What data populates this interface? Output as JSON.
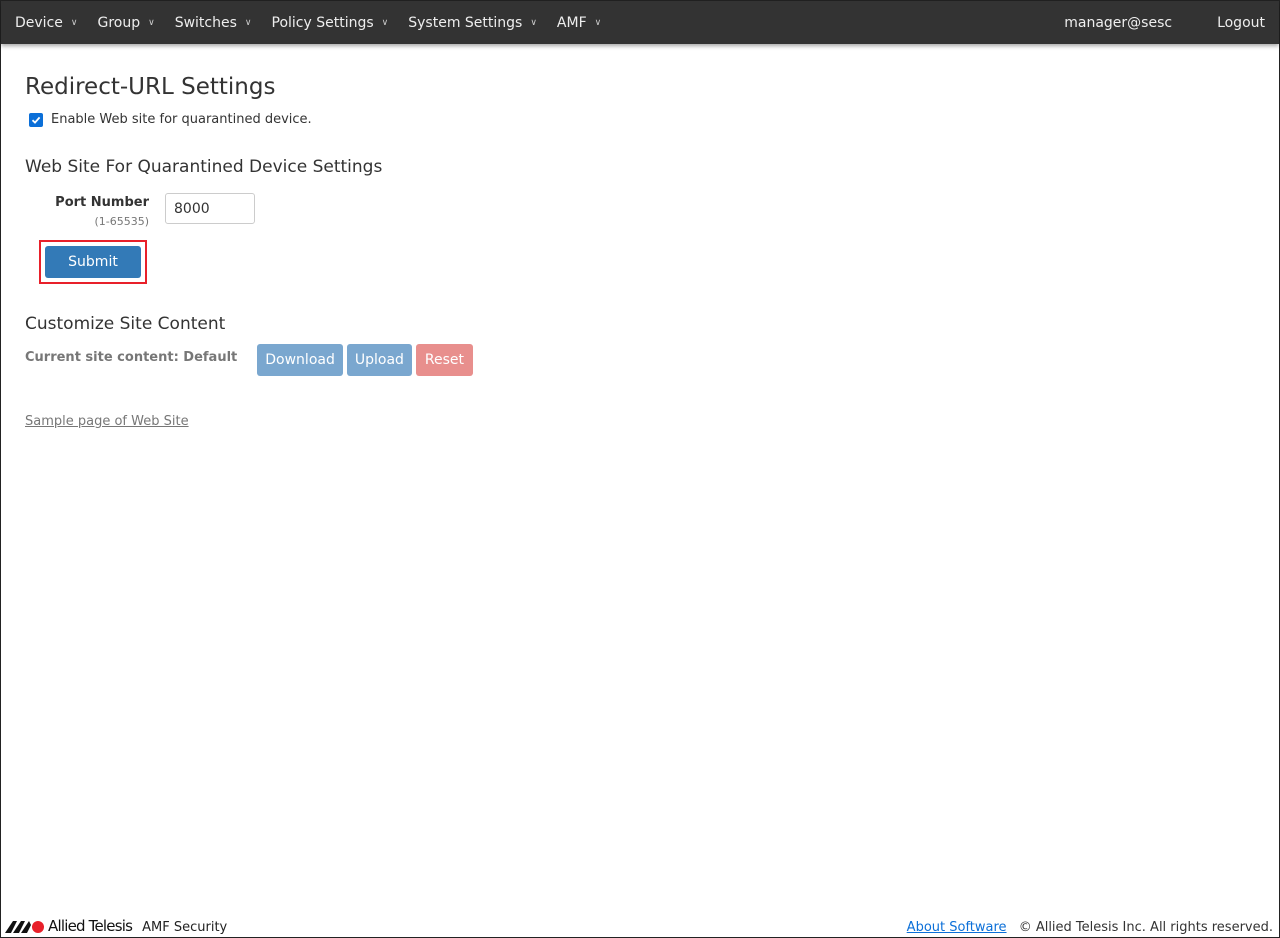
{
  "nav": {
    "items": [
      {
        "label": "Device"
      },
      {
        "label": "Group"
      },
      {
        "label": "Switches"
      },
      {
        "label": "Policy Settings"
      },
      {
        "label": "System Settings"
      },
      {
        "label": "AMF"
      }
    ],
    "user": "manager@sesc",
    "logout": "Logout"
  },
  "page": {
    "title": "Redirect-URL Settings",
    "enable_label": "Enable Web site for quarantined device.",
    "enable_checked": true
  },
  "web_site": {
    "heading": "Web Site For Quarantined Device Settings",
    "port_label": "Port Number",
    "port_hint": "(1-65535)",
    "port_value": "8000",
    "submit": "Submit"
  },
  "customize": {
    "heading": "Customize Site Content",
    "current_label": "Current site content: Default",
    "download": "Download",
    "upload": "Upload",
    "reset": "Reset",
    "sample_link": "Sample page of Web Site"
  },
  "footer": {
    "logo_text": "Allied Telesis",
    "product": "AMF Security",
    "about": "About Software",
    "copyright": "© Allied Telesis Inc. All rights reserved."
  },
  "colors": {
    "navbar": "#333333",
    "primary": "#337ab7",
    "highlight": "#e8202a",
    "danger_faded": "#e88f8d"
  }
}
